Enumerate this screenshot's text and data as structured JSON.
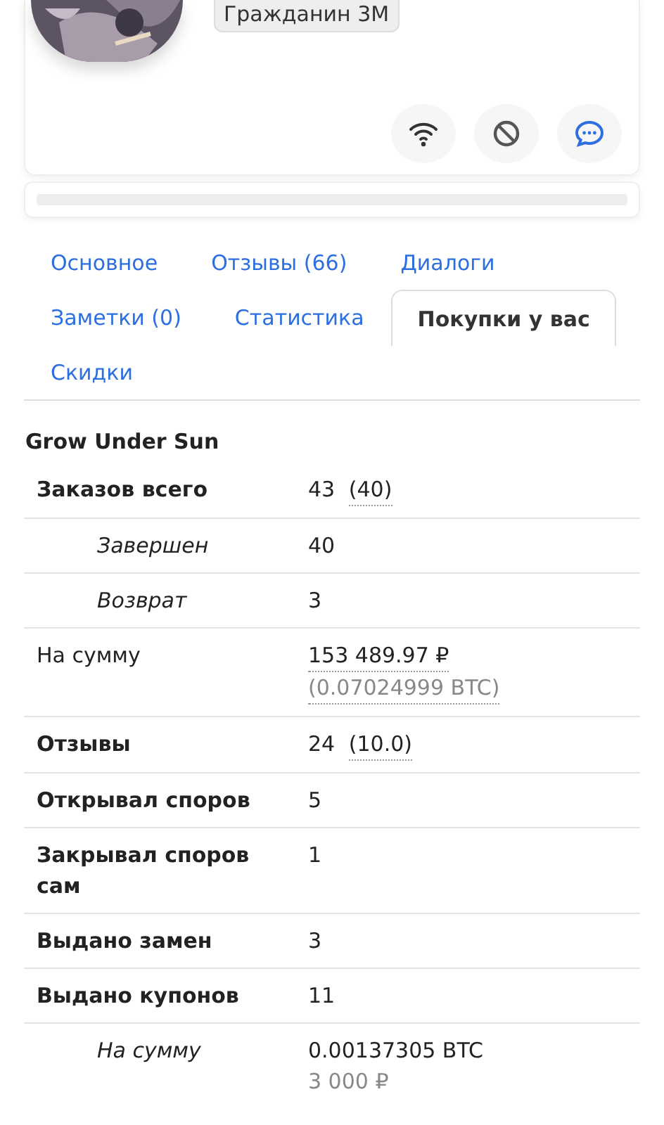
{
  "profile": {
    "rank_badge": "Гражданин 3М",
    "actions": [
      {
        "kind": "follow"
      },
      {
        "kind": "block"
      },
      {
        "kind": "message"
      }
    ]
  },
  "tabs": [
    {
      "label": "Основное",
      "selected": false
    },
    {
      "label": "Отзывы (66)",
      "selected": false
    },
    {
      "label": "Диалоги",
      "selected": false
    },
    {
      "label": "Заметки (0)",
      "selected": false
    },
    {
      "label": "Статистика",
      "selected": false
    },
    {
      "label": "Покупки у вас",
      "selected": true
    },
    {
      "label": "Скидки",
      "selected": false
    }
  ],
  "table": {
    "title": "Grow Under Sun",
    "rows": [
      {
        "kind": "total",
        "label": "Заказов всего",
        "parts": [
          {
            "text": "43",
            "underline": false,
            "muted": false
          },
          {
            "text": "(40)",
            "underline": true,
            "muted": false
          }
        ]
      },
      {
        "kind": "sub",
        "label": "Завершен",
        "parts": [
          {
            "text": "40",
            "underline": false,
            "muted": false
          }
        ]
      },
      {
        "kind": "sub",
        "label": "Возврат",
        "parts": [
          {
            "text": "3",
            "underline": false,
            "muted": false
          }
        ]
      },
      {
        "kind": "plain",
        "label": "На сумму",
        "parts": [
          {
            "text": "153 489.97 ₽",
            "underline": true,
            "muted": false
          },
          {
            "text": "(0.07024999 BTC)",
            "underline": true,
            "muted": true
          }
        ]
      },
      {
        "kind": "total",
        "label": "Отзывы",
        "parts": [
          {
            "text": "24",
            "underline": false,
            "muted": false
          },
          {
            "text": "(10.0)",
            "underline": true,
            "muted": false
          }
        ]
      },
      {
        "kind": "total",
        "label": "Открывал споров",
        "parts": [
          {
            "text": "5",
            "underline": false,
            "muted": false
          }
        ]
      },
      {
        "kind": "total",
        "label": "Закрывал споров сам",
        "parts": [
          {
            "text": "1",
            "underline": false,
            "muted": false
          }
        ]
      },
      {
        "kind": "total",
        "label": "Выдано замен",
        "parts": [
          {
            "text": "3",
            "underline": false,
            "muted": false
          }
        ]
      },
      {
        "kind": "total",
        "label": "Выдано купонов",
        "parts": [
          {
            "text": "11",
            "underline": false,
            "muted": false
          }
        ]
      },
      {
        "kind": "sub",
        "label": "На сумму",
        "parts": [
          {
            "text": "0.00137305 BTC",
            "underline": false,
            "muted": false
          },
          {
            "text": "3 000 ₽",
            "underline": false,
            "muted": true
          }
        ]
      }
    ]
  }
}
